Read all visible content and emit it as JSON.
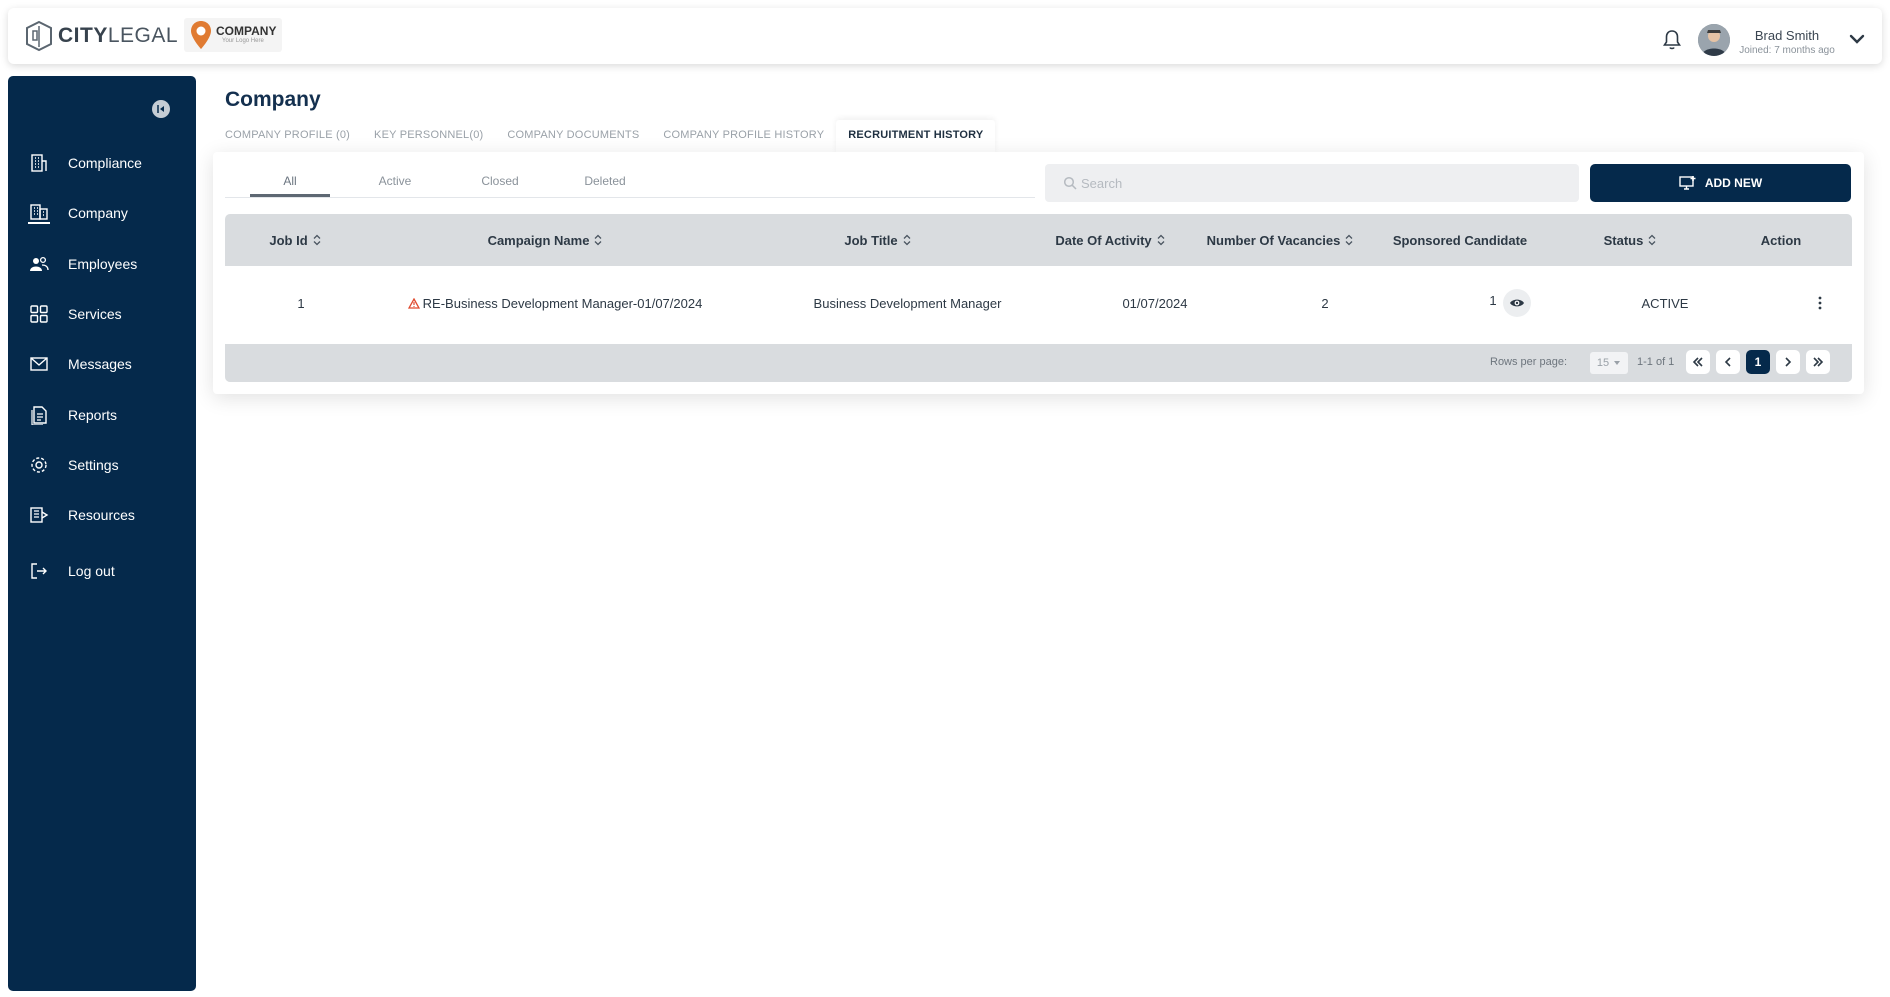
{
  "brand": {
    "name_bold": "CITY",
    "name_light": "LEGAL"
  },
  "company_logo": {
    "name": "COMPANY",
    "tagline": "Your Logo Here"
  },
  "user": {
    "name": "Brad Smith",
    "joined": "Joined: 7 months ago"
  },
  "sidebar": {
    "items": [
      {
        "label": "Compliance",
        "icon": "compliance-building-icon"
      },
      {
        "label": "Company",
        "icon": "company-buildings-icon"
      },
      {
        "label": "Employees",
        "icon": "employees-icon"
      },
      {
        "label": "Services",
        "icon": "services-grid-icon"
      },
      {
        "label": "Messages",
        "icon": "envelope-icon"
      },
      {
        "label": "Reports",
        "icon": "reports-doc-icon"
      },
      {
        "label": "Settings",
        "icon": "gear-icon"
      },
      {
        "label": "Resources",
        "icon": "resources-icon"
      },
      {
        "label": "Log out",
        "icon": "logout-icon"
      }
    ]
  },
  "page": {
    "title": "Company"
  },
  "tabs": [
    {
      "label": "COMPANY PROFILE (0)"
    },
    {
      "label": "KEY PERSONNEL(0)"
    },
    {
      "label": "COMPANY DOCUMENTS"
    },
    {
      "label": "COMPANY PROFILE HISTORY"
    },
    {
      "label": "RECRUITMENT HISTORY"
    }
  ],
  "filters": [
    "All",
    "Active",
    "Closed",
    "Deleted"
  ],
  "search": {
    "placeholder": "Search"
  },
  "add_button": {
    "label": "ADD NEW"
  },
  "table": {
    "headers": [
      "Job Id",
      "Campaign Name",
      "Job Title",
      "Date Of Activity",
      "Number Of Vacancies",
      "Sponsored Candidate",
      "Status",
      "Action"
    ],
    "rows": [
      {
        "job_id": "1",
        "campaign": "RE-Business Development Manager-01/07/2024",
        "job_title": "Business Development Manager",
        "date": "01/07/2024",
        "vacancies": "2",
        "sponsored": "1",
        "status": "ACTIVE"
      }
    ]
  },
  "pagination": {
    "rows_per_page_label": "Rows per page:",
    "rows_per_page": "15",
    "range": "1-1 of 1",
    "current_page": "1"
  },
  "colors": {
    "navy": "#05294b",
    "warning": "#e04a2f"
  }
}
